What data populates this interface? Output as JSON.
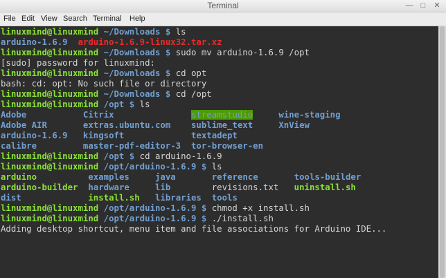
{
  "window": {
    "title": "Terminal"
  },
  "menu": [
    "File",
    "Edit",
    "View",
    "Search",
    "Terminal",
    "Help"
  ],
  "colors": {
    "prompt_user": "#8ae234",
    "prompt_path": "#729fcf",
    "dir": "#729fcf",
    "archive": "#ef2929",
    "executable": "#8ae234",
    "text": "#d6d6d6",
    "background": "#2d2d2d"
  },
  "lines": [
    [
      {
        "t": "linuxmind@linuxmind",
        "c": "g"
      },
      {
        "t": " ~/Downloads $ ",
        "c": "bb"
      },
      {
        "t": "ls",
        "c": "w"
      }
    ],
    [
      {
        "t": "arduino-1.6.9",
        "c": "bb"
      },
      {
        "t": "  ",
        "c": "w"
      },
      {
        "t": "arduino-1.6.9-linux32.tar.xz",
        "c": "r"
      }
    ],
    [
      {
        "t": "linuxmind@linuxmind",
        "c": "g"
      },
      {
        "t": " ~/Downloads $ ",
        "c": "bb"
      },
      {
        "t": "sudo mv arduino-1.6.9 /opt",
        "c": "w"
      }
    ],
    [
      {
        "t": "[sudo] password for linuxmind:",
        "c": "w"
      }
    ],
    [
      {
        "t": "linuxmind@linuxmind",
        "c": "g"
      },
      {
        "t": " ~/Downloads $ ",
        "c": "bb"
      },
      {
        "t": "cd opt",
        "c": "w"
      }
    ],
    [
      {
        "t": "bash: cd: opt: No such file or directory",
        "c": "w"
      }
    ],
    [
      {
        "t": "linuxmind@linuxmind",
        "c": "g"
      },
      {
        "t": " ~/Downloads $ ",
        "c": "bb"
      },
      {
        "t": "cd /opt",
        "c": "w"
      }
    ],
    [
      {
        "t": "linuxmind@linuxmind",
        "c": "g"
      },
      {
        "t": " /opt $ ",
        "c": "bb"
      },
      {
        "t": "ls",
        "c": "w"
      }
    ],
    [
      {
        "t": "Adobe           ",
        "c": "bb"
      },
      {
        "t": "Citrix",
        "c": "bb"
      },
      {
        "t": "               ",
        "c": "w"
      },
      {
        "t": "streamstudio",
        "c": "hl"
      },
      {
        "t": "     ",
        "c": "w"
      },
      {
        "t": "wine-staging",
        "c": "bb"
      }
    ],
    [
      {
        "t": "Adobe AIR       ",
        "c": "bb"
      },
      {
        "t": "extras.ubuntu.com",
        "c": "bb"
      },
      {
        "t": "    ",
        "c": "w"
      },
      {
        "t": "sublime_text",
        "c": "bb"
      },
      {
        "t": "     ",
        "c": "w"
      },
      {
        "t": "XnView",
        "c": "bb"
      }
    ],
    [
      {
        "t": "arduino-1.6.9   ",
        "c": "bb"
      },
      {
        "t": "kingsoft",
        "c": "bb"
      },
      {
        "t": "             ",
        "c": "w"
      },
      {
        "t": "textadept",
        "c": "bb"
      }
    ],
    [
      {
        "t": "calibre         ",
        "c": "bb"
      },
      {
        "t": "master-pdf-editor-3",
        "c": "bb"
      },
      {
        "t": "  ",
        "c": "w"
      },
      {
        "t": "tor-browser-en",
        "c": "bb"
      }
    ],
    [
      {
        "t": "linuxmind@linuxmind",
        "c": "g"
      },
      {
        "t": " /opt $ ",
        "c": "bb"
      },
      {
        "t": "cd arduino-1.6.9",
        "c": "w"
      }
    ],
    [
      {
        "t": "linuxmind@linuxmind",
        "c": "g"
      },
      {
        "t": " /opt/arduino-1.6.9 $ ",
        "c": "bb"
      },
      {
        "t": "ls",
        "c": "w"
      }
    ],
    [
      {
        "t": "arduino",
        "c": "gb"
      },
      {
        "t": "          ",
        "c": "w"
      },
      {
        "t": "examples",
        "c": "bb"
      },
      {
        "t": "     ",
        "c": "w"
      },
      {
        "t": "java",
        "c": "bb"
      },
      {
        "t": "       ",
        "c": "w"
      },
      {
        "t": "reference",
        "c": "bb"
      },
      {
        "t": "       ",
        "c": "w"
      },
      {
        "t": "tools-builder",
        "c": "bb"
      }
    ],
    [
      {
        "t": "arduino-builder",
        "c": "gb"
      },
      {
        "t": "  ",
        "c": "w"
      },
      {
        "t": "hardware",
        "c": "bb"
      },
      {
        "t": "     ",
        "c": "w"
      },
      {
        "t": "lib",
        "c": "bb"
      },
      {
        "t": "        ",
        "c": "w"
      },
      {
        "t": "revisions.txt",
        "c": "w"
      },
      {
        "t": "   ",
        "c": "w"
      },
      {
        "t": "uninstall.sh",
        "c": "gb"
      }
    ],
    [
      {
        "t": "dist",
        "c": "bb"
      },
      {
        "t": "             ",
        "c": "w"
      },
      {
        "t": "install.sh",
        "c": "gb"
      },
      {
        "t": "   ",
        "c": "w"
      },
      {
        "t": "libraries",
        "c": "bb"
      },
      {
        "t": "  ",
        "c": "w"
      },
      {
        "t": "tools",
        "c": "bb"
      }
    ],
    [
      {
        "t": "linuxmind@linuxmind",
        "c": "g"
      },
      {
        "t": " /opt/arduino-1.6.9 $ ",
        "c": "bb"
      },
      {
        "t": "chmod +x install.sh",
        "c": "w"
      }
    ],
    [
      {
        "t": "linuxmind@linuxmind",
        "c": "g"
      },
      {
        "t": " /opt/arduino-1.6.9 $ ",
        "c": "bb"
      },
      {
        "t": "./install.sh",
        "c": "w"
      }
    ],
    [
      {
        "t": "Adding desktop shortcut, menu item and file associations for Arduino IDE...",
        "c": "w"
      }
    ]
  ]
}
